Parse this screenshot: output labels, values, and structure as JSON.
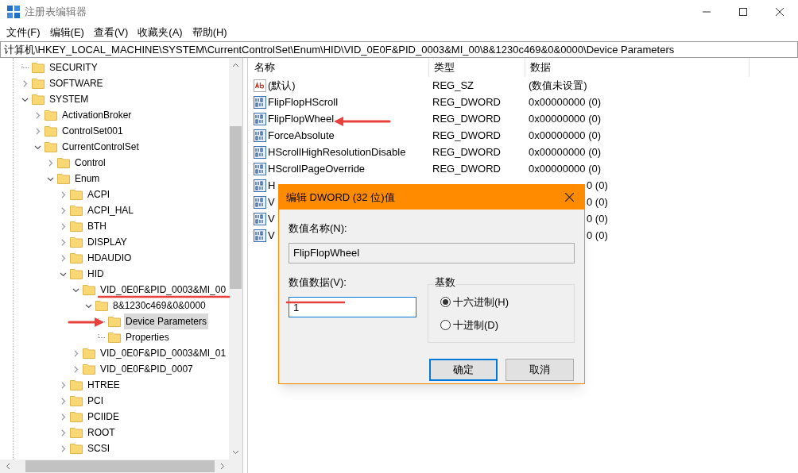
{
  "window": {
    "title": "注册表编辑器"
  },
  "menu": [
    "文件(F)",
    "编辑(E)",
    "查看(V)",
    "收藏夹(A)",
    "帮助(H)"
  ],
  "address": "计算机\\HKEY_LOCAL_MACHINE\\SYSTEM\\CurrentControlSet\\Enum\\HID\\VID_0E0F&PID_0003&MI_00\\8&1230c469&0&0000\\Device Parameters",
  "tree": [
    {
      "label": "SECURITY",
      "kind": "leaf",
      "selected": false
    },
    {
      "label": "SOFTWARE",
      "kind": "folder",
      "expanded": false,
      "selected": false
    },
    {
      "label": "SYSTEM",
      "kind": "folder",
      "expanded": true,
      "selected": false,
      "children": [
        {
          "label": "ActivationBroker",
          "kind": "folder",
          "expanded": false,
          "selected": false
        },
        {
          "label": "ControlSet001",
          "kind": "folder",
          "expanded": false,
          "selected": false
        },
        {
          "label": "CurrentControlSet",
          "kind": "folder",
          "expanded": true,
          "selected": false,
          "children": [
            {
              "label": "Control",
              "kind": "folder",
              "expanded": false,
              "selected": false
            },
            {
              "label": "Enum",
              "kind": "folder",
              "expanded": true,
              "selected": false,
              "children": [
                {
                  "label": "ACPI",
                  "kind": "folder",
                  "expanded": false,
                  "selected": false
                },
                {
                  "label": "ACPI_HAL",
                  "kind": "folder",
                  "expanded": false,
                  "selected": false
                },
                {
                  "label": "BTH",
                  "kind": "folder",
                  "expanded": false,
                  "selected": false
                },
                {
                  "label": "DISPLAY",
                  "kind": "folder",
                  "expanded": false,
                  "selected": false
                },
                {
                  "label": "HDAUDIO",
                  "kind": "folder",
                  "expanded": false,
                  "selected": false
                },
                {
                  "label": "HID",
                  "kind": "folder",
                  "expanded": true,
                  "selected": false,
                  "children": [
                    {
                      "label": "VID_0E0F&PID_0003&MI_00",
                      "kind": "folder",
                      "expanded": true,
                      "selected": false,
                      "children": [
                        {
                          "label": "8&1230c469&0&0000",
                          "kind": "folder",
                          "expanded": true,
                          "selected": false,
                          "children": [
                            {
                              "label": "Device Parameters",
                              "kind": "leaf",
                              "selected": true
                            },
                            {
                              "label": "Properties",
                              "kind": "leaf",
                              "selected": false
                            }
                          ]
                        }
                      ]
                    },
                    {
                      "label": "VID_0E0F&PID_0003&MI_01",
                      "kind": "folder",
                      "expanded": false,
                      "selected": false
                    },
                    {
                      "label": "VID_0E0F&PID_0007",
                      "kind": "folder",
                      "expanded": false,
                      "selected": false
                    }
                  ]
                },
                {
                  "label": "HTREE",
                  "kind": "folder",
                  "expanded": false,
                  "selected": false
                },
                {
                  "label": "PCI",
                  "kind": "folder",
                  "expanded": false,
                  "selected": false
                },
                {
                  "label": "PCIIDE",
                  "kind": "folder",
                  "expanded": false,
                  "selected": false
                },
                {
                  "label": "ROOT",
                  "kind": "folder",
                  "expanded": false,
                  "selected": false
                },
                {
                  "label": "SCSI",
                  "kind": "folder",
                  "expanded": false,
                  "selected": false
                }
              ]
            }
          ]
        }
      ]
    }
  ],
  "table": {
    "columns": [
      "名称",
      "类型",
      "数据"
    ],
    "rows": [
      {
        "kind": "string",
        "name": "(默认)",
        "type": "REG_SZ",
        "data": "(数值未设置)"
      },
      {
        "kind": "dword",
        "name": "FlipFlopHScroll",
        "type": "REG_DWORD",
        "data": "0x00000000 (0)"
      },
      {
        "kind": "dword",
        "name": "FlipFlopWheel",
        "type": "REG_DWORD",
        "data": "0x00000000 (0)"
      },
      {
        "kind": "dword",
        "name": "ForceAbsolute",
        "type": "REG_DWORD",
        "data": "0x00000000 (0)"
      },
      {
        "kind": "dword",
        "name": "HScrollHighResolutionDisable",
        "type": "REG_DWORD",
        "data": "0x00000000 (0)"
      },
      {
        "kind": "dword",
        "name": "HScrollPageOverride",
        "type": "REG_DWORD",
        "data": "0x00000000 (0)"
      },
      {
        "kind": "covered",
        "name": "H",
        "data": "0 (0)"
      },
      {
        "kind": "covered",
        "name": "V",
        "data": "0 (0)"
      },
      {
        "kind": "covered",
        "name": "V",
        "data": "0 (0)"
      },
      {
        "kind": "covered",
        "name": "V",
        "data": "0 (0)"
      }
    ]
  },
  "dialog": {
    "title": "编辑 DWORD (32 位)值",
    "name_label": "数值名称(N):",
    "name_value": "FlipFlopWheel",
    "data_label": "数值数据(V):",
    "data_value": "1",
    "base_label": "基数",
    "bases": [
      {
        "label": "十六进制(H)",
        "selected": true
      },
      {
        "label": "十进制(D)",
        "selected": false
      }
    ],
    "buttons": [
      {
        "label": "确定",
        "default": true
      },
      {
        "label": "取消",
        "default": false
      }
    ]
  }
}
